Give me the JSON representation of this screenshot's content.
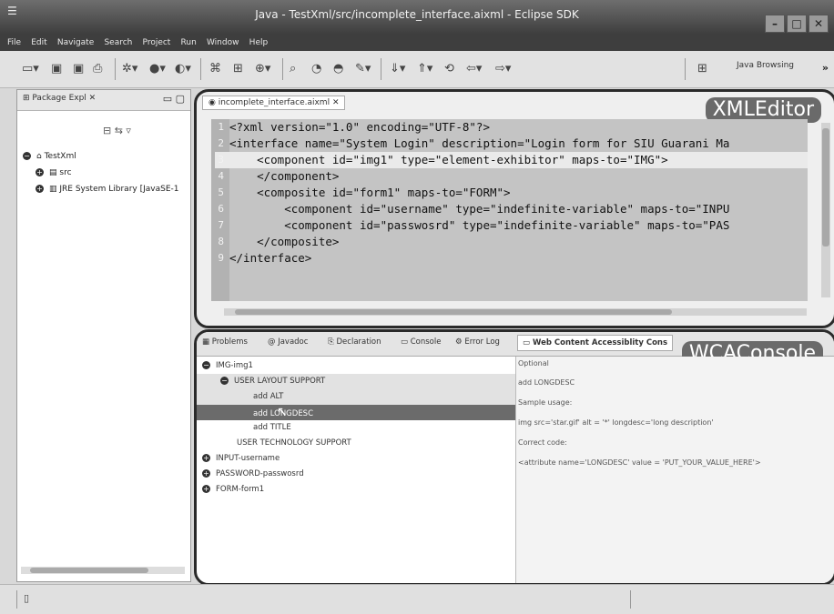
{
  "window": {
    "title": "Java - TestXml/src/incomplete_interface.aixml - Eclipse SDK"
  },
  "menu": [
    "File",
    "Edit",
    "Navigate",
    "Search",
    "Project",
    "Run",
    "Window",
    "Help"
  ],
  "toolbar": {
    "perspective_label": "Java Browsing",
    "more": "»"
  },
  "package_explorer": {
    "tab_label": "Package Expl",
    "tree": [
      {
        "label": "TestXml",
        "toggle": "−"
      },
      {
        "label": "src",
        "toggle": "+"
      },
      {
        "label": "JRE System Library [JavaSE-1",
        "toggle": "+"
      }
    ]
  },
  "editor": {
    "tab_label": "incomplete_interface.aixml",
    "overlay_label": "XMLEditor",
    "lines": [
      {
        "n": "1",
        "text": "<?xml version=\"1.0\" encoding=\"UTF-8\"?>"
      },
      {
        "n": "2",
        "text": "<interface name=\"System Login\" description=\"Login form for SIU Guarani Ma"
      },
      {
        "n": "3",
        "text": "    <component id=\"img1\" type=\"element-exhibitor\" maps-to=\"IMG\">"
      },
      {
        "n": "4",
        "text": "    </component>"
      },
      {
        "n": "5",
        "text": "    <composite id=\"form1\" maps-to=\"FORM\">"
      },
      {
        "n": "6",
        "text": "        <component id=\"username\" type=\"indefinite-variable\" maps-to=\"INPU"
      },
      {
        "n": "7",
        "text": "        <component id=\"passwosrd\" type=\"indefinite-variable\" maps-to=\"PAS"
      },
      {
        "n": "8",
        "text": "    </composite>"
      },
      {
        "n": "9",
        "text": "</interface>"
      }
    ]
  },
  "console": {
    "overlay_label": "WCAConsole",
    "tabs": [
      "Problems",
      "@ Javadoc",
      "Declaration",
      "Console",
      "Error Log",
      "Web Content Accessiblity Cons"
    ],
    "tree": [
      {
        "label": "IMG-img1",
        "toggle": "−",
        "level": 0
      },
      {
        "label": "USER LAYOUT SUPPORT",
        "toggle": "−",
        "level": 1
      },
      {
        "label": "add ALT",
        "toggle": "",
        "level": 2
      },
      {
        "label": "add LONGDESC",
        "toggle": "",
        "level": 2
      },
      {
        "label": "add TITLE",
        "toggle": "",
        "level": 2
      },
      {
        "label": "USER TECHNOLOGY SUPPORT",
        "toggle": "",
        "level": 1
      },
      {
        "label": "INPUT-username",
        "toggle": "+",
        "level": 0
      },
      {
        "label": "PASSWORD-passwosrd",
        "toggle": "+",
        "level": 0
      },
      {
        "label": "FORM-form1",
        "toggle": "+",
        "level": 0
      }
    ],
    "details": [
      "Optional",
      "add LONGDESC",
      "Sample usage:",
      "img src='star.gif' alt = '*' longdesc='long description'",
      "Correct code:",
      "<attribute name='LONGDESC' value = 'PUT_YOUR_VALUE_HERE'>"
    ]
  },
  "colors": {
    "selected_row": "#6b6b6b",
    "code_bg": "#c4c4c4",
    "overlay_bg": "#6a6a6a"
  }
}
